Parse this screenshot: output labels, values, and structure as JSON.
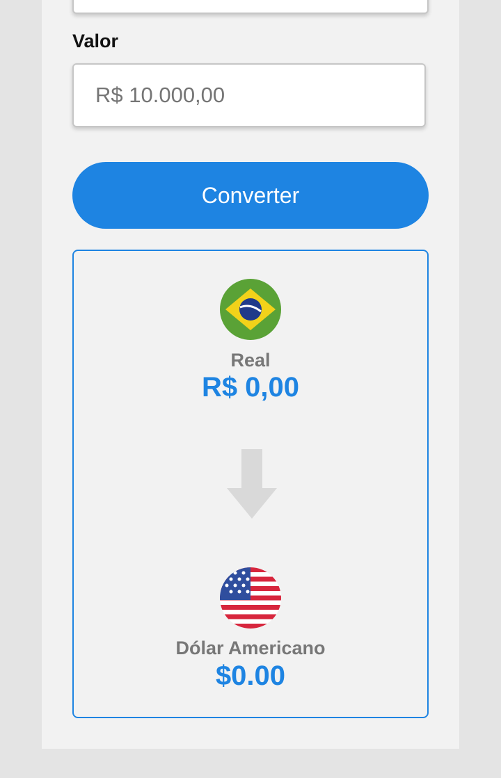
{
  "form": {
    "valor_label": "Valor",
    "valor_placeholder": "R$ 10.000,00",
    "valor_value": "",
    "convert_label": "Converter"
  },
  "result": {
    "from": {
      "name": "Real",
      "value": "R$ 0,00",
      "icon": "brazil-flag-icon"
    },
    "to": {
      "name": "Dólar Americano",
      "value": "$0.00",
      "icon": "usa-flag-icon"
    },
    "arrow_icon": "arrow-down-icon"
  },
  "colors": {
    "accent": "#1e84e2",
    "panel": "#f2f2f2",
    "background": "#e4e4e4",
    "muted_text": "#777777"
  }
}
